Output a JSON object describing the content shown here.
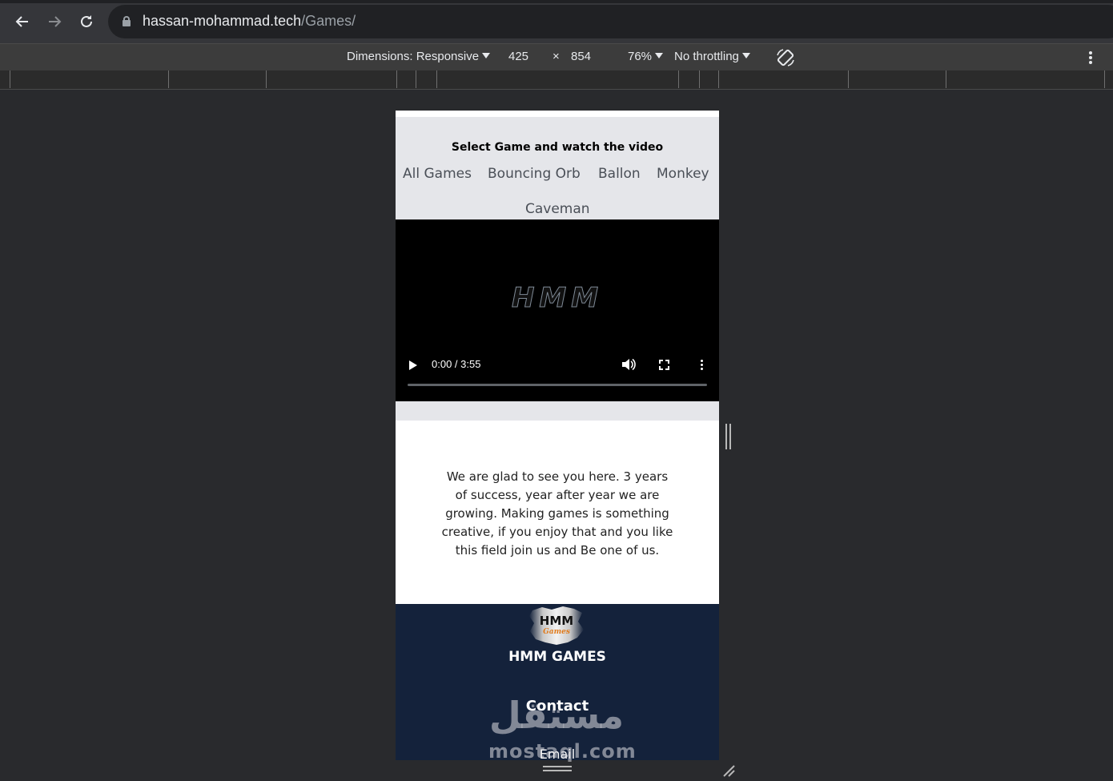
{
  "browser": {
    "url_host": "hassan-mohammad.tech",
    "url_path": "/Games/"
  },
  "devtools": {
    "dimensions_label": "Dimensions: Responsive",
    "width": "425",
    "times": "×",
    "height": "854",
    "zoom": "76%",
    "throttling": "No throttling"
  },
  "page": {
    "select_title": "Select Game and watch the video",
    "games": [
      "All Games",
      "Bouncing Orb",
      "Ballon",
      "Monkey",
      "Caveman"
    ],
    "video": {
      "logo_text": "HMM",
      "time": "0:00 / 3:55",
      "progress": 0.0
    },
    "welcome_text": "We are glad to see you here. 3 years of success, year after year we are growing. Making games is something creative, if you enjoy that and you like this field join us and Be one of us.",
    "footer": {
      "logo_top": "HMM",
      "logo_bottom": "Games",
      "brand": "HMM GAMES",
      "contact": "Contact",
      "email": "Email"
    }
  },
  "watermark": {
    "arabic": "مستقل",
    "latin": "mostaql.com"
  },
  "icons": {
    "back": "back-arrow-icon",
    "forward": "forward-arrow-icon",
    "reload": "reload-icon",
    "lock": "lock-icon",
    "rotate": "rotate-device-icon",
    "more": "more-vert-icon",
    "play": "play-icon",
    "volume": "volume-icon",
    "fullscreen": "fullscreen-icon"
  }
}
